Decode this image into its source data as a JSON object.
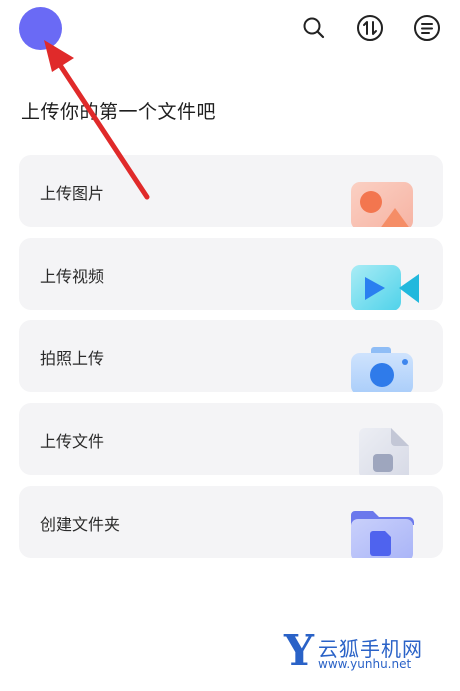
{
  "header": {
    "avatar_color": "#6a6af5",
    "icons": [
      "search-icon",
      "transfer-icon",
      "menu-icon"
    ]
  },
  "main": {
    "heading": "上传你的第一个文件吧",
    "options": [
      {
        "label": "上传图片",
        "icon": "image-upload-icon"
      },
      {
        "label": "上传视频",
        "icon": "video-upload-icon"
      },
      {
        "label": "拍照上传",
        "icon": "camera-icon"
      },
      {
        "label": "上传文件",
        "icon": "file-upload-icon"
      },
      {
        "label": "创建文件夹",
        "icon": "folder-create-icon"
      }
    ]
  },
  "annotation": {
    "arrow_color": "#e02a2a"
  },
  "watermark": {
    "logo_letter": "Y",
    "name": "云狐手机网",
    "url": "www.yunhu.net"
  }
}
